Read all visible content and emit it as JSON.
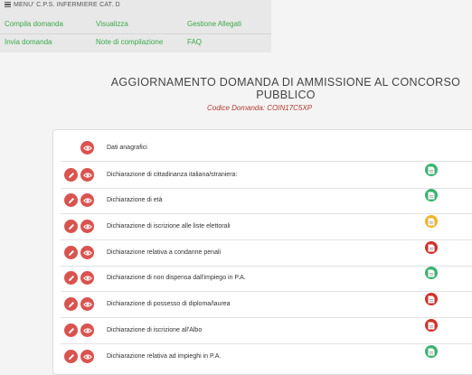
{
  "menu": {
    "title": "MENU' C.P.S. INFERMIERE CAT. D",
    "links": [
      {
        "label": "Compila domanda",
        "name": "menu-compila-domanda"
      },
      {
        "label": "Visualizza",
        "name": "menu-visualizza"
      },
      {
        "label": "Gestione Allegati",
        "name": "menu-gestione-allegati"
      },
      {
        "label": "Invia domanda",
        "name": "menu-invia-domanda"
      },
      {
        "label": "Note di compilazione",
        "name": "menu-note-compilazione"
      },
      {
        "label": "FAQ",
        "name": "menu-faq"
      }
    ]
  },
  "page": {
    "title": "AGGIORNAMENTO DOMANDA DI AMMISSIONE AL CONCORSO PUBBLICO",
    "code": "Codice Domanda: COIN17C5XP"
  },
  "colors": {
    "action_red": "#d9534f",
    "status_green": "#3cb371",
    "status_yellow": "#f0b429",
    "status_red": "#d0322b",
    "link_green": "#3aaa4a"
  },
  "rows": [
    {
      "label": "Dati anagrafici",
      "editable": false,
      "status": null
    },
    {
      "label": "Dichiarazione di cittadinanza italiana/straniera:",
      "editable": true,
      "status": "green"
    },
    {
      "label": "Dichiarazione di età",
      "editable": true,
      "status": "green"
    },
    {
      "label": "Dichiarazione di iscrizione alle liste elettorali",
      "editable": true,
      "status": "yellow"
    },
    {
      "label": "Dichiarazione relativa a condanne penali",
      "editable": true,
      "status": "red"
    },
    {
      "label": "Dichiarazione di non dispensa dall'impiego in P.A.",
      "editable": true,
      "status": "green"
    },
    {
      "label": "Dichiarazione di possesso di diploma/laurea",
      "editable": true,
      "status": "red"
    },
    {
      "label": "Dichiarazione di iscrizione all'Albo",
      "editable": true,
      "status": "red"
    },
    {
      "label": "Dichiarazione relativa ad impieghi in P.A.",
      "editable": true,
      "status": "green"
    }
  ],
  "icons": {
    "edit": "pencil-icon",
    "view": "eye-icon",
    "status": "document-icon"
  }
}
